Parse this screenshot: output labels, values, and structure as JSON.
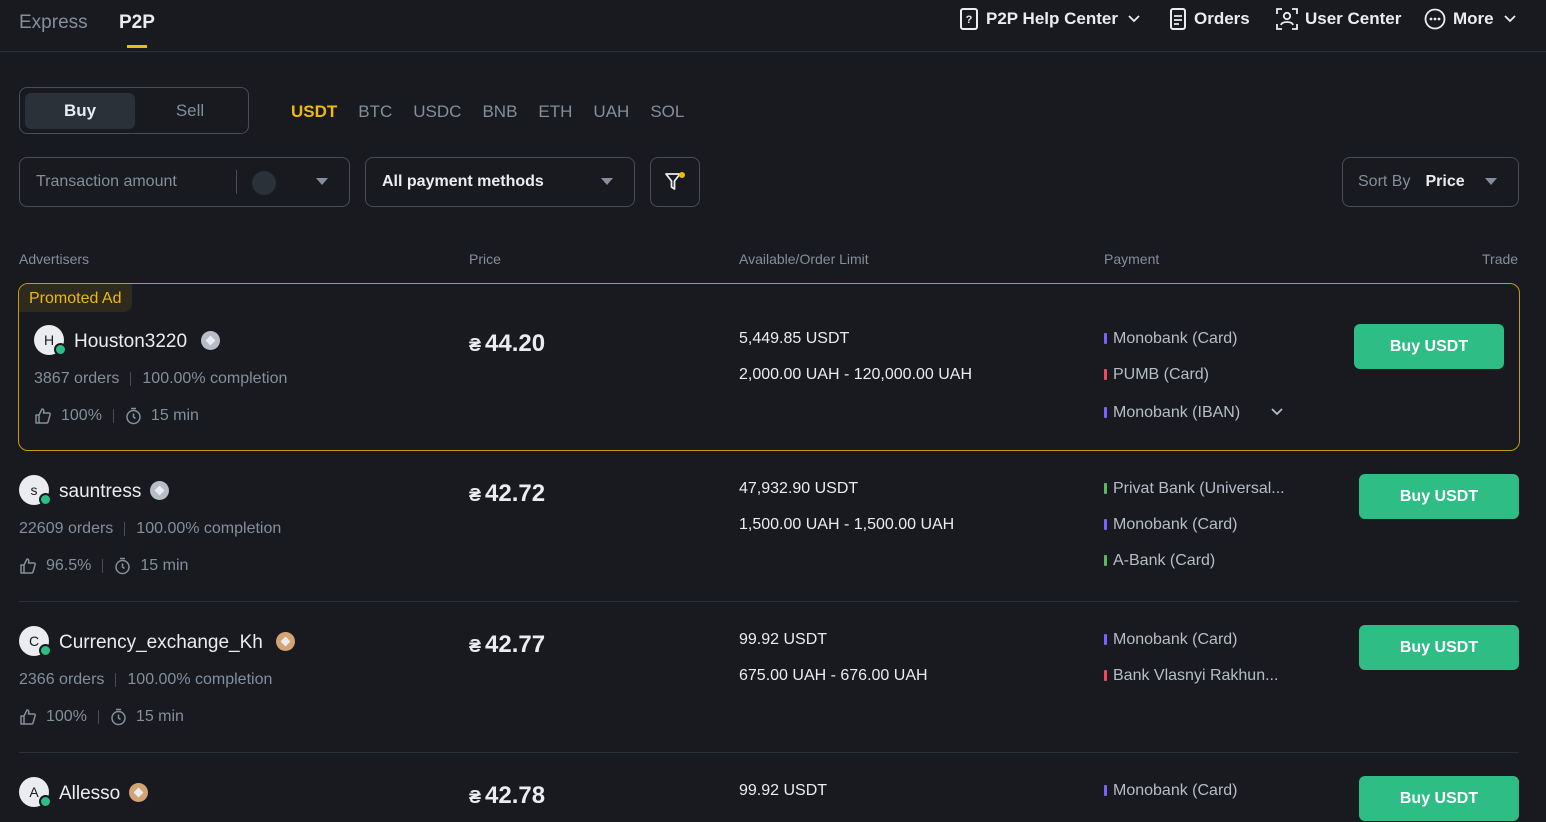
{
  "top_tabs": {
    "express": "Express",
    "p2p": "P2P"
  },
  "nav": {
    "help": "P2P Help Center",
    "orders": "Orders",
    "user_center": "User Center",
    "more": "More"
  },
  "toggle": {
    "buy": "Buy",
    "sell": "Sell"
  },
  "coins": [
    "USDT",
    "BTC",
    "USDC",
    "BNB",
    "ETH",
    "UAH",
    "SOL"
  ],
  "filters": {
    "amount_placeholder": "Transaction amount",
    "payment": "All payment methods",
    "sort_label": "Sort By",
    "sort_value": "Price"
  },
  "headers": {
    "advertisers": "Advertisers",
    "price": "Price",
    "available": "Available/Order Limit",
    "payment": "Payment",
    "trade": "Trade"
  },
  "promo_label": "Promoted Ad",
  "currency_symbol": "₴",
  "colors": {
    "accent": "#f0b90b",
    "buy": "#2ebd85",
    "monobank": "#7b61ff",
    "pumb": "#f6465d",
    "privat": "#5cb85c",
    "abank": "#5cb85c",
    "vlasnyi": "#f6465d"
  },
  "ads": [
    {
      "name": "Houston3220",
      "initial": "H",
      "orders": "3867 orders",
      "completion": "100.00% completion",
      "like": "100%",
      "time": "15 min",
      "price": "44.20",
      "available": "5,449.85 USDT",
      "limit": "2,000.00 UAH - 120,000.00 UAH",
      "payments": [
        "Monobank (Card)",
        "PUMB (Card)",
        "Monobank (IBAN)"
      ],
      "button": "Buy USDT"
    },
    {
      "name": "sauntress",
      "initial": "s",
      "orders": "22609 orders",
      "completion": "100.00% completion",
      "like": "96.5%",
      "time": "15 min",
      "price": "42.72",
      "available": "47,932.90 USDT",
      "limit": "1,500.00 UAH - 1,500.00 UAH",
      "payments": [
        "Privat Bank (Universal...",
        "Monobank (Card)",
        "A-Bank (Card)"
      ],
      "button": "Buy USDT"
    },
    {
      "name": "Currency_exchange_Kh",
      "initial": "C",
      "orders": "2366 orders",
      "completion": "100.00% completion",
      "like": "100%",
      "time": "15 min",
      "price": "42.77",
      "available": "99.92 USDT",
      "limit": "675.00 UAH - 676.00 UAH",
      "payments": [
        "Monobank (Card)",
        "Bank Vlasnyi Rakhun..."
      ],
      "button": "Buy USDT"
    },
    {
      "name": "Allesso",
      "initial": "A",
      "price": "42.78",
      "available": "99.92 USDT",
      "payments": [
        "Monobank (Card)"
      ],
      "button": "Buy USDT"
    }
  ]
}
